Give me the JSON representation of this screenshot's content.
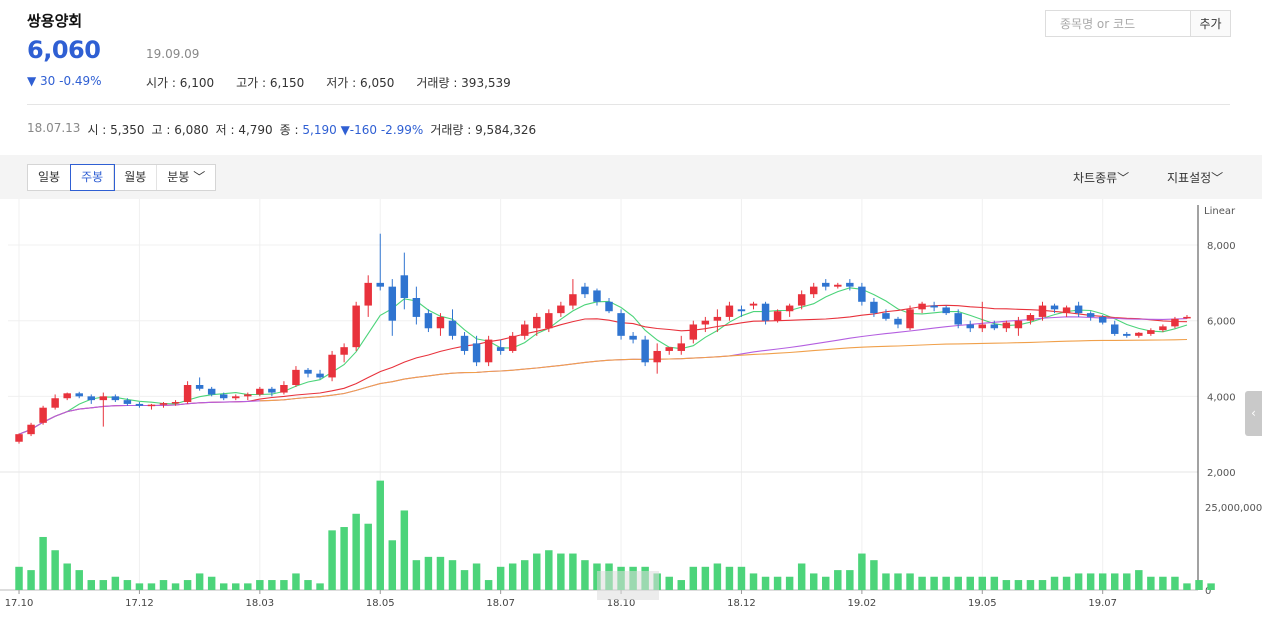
{
  "header": {
    "name": "쌍용양회",
    "price": "6,060",
    "date": "19.09.09",
    "change": "▼ 30 -0.49%",
    "ohlc": [
      {
        "label": "시가",
        "value": "6,100"
      },
      {
        "label": "고가",
        "value": "6,150"
      },
      {
        "label": "저가",
        "value": "6,050"
      },
      {
        "label": "거래량",
        "value": "393,539"
      }
    ]
  },
  "history": {
    "date": "18.07.13",
    "open_label": "시",
    "open": "5,350",
    "high_label": "고",
    "high": "6,080",
    "low_label": "저",
    "low": "4,790",
    "close_label": "종",
    "close": "5,190",
    "change": "▼-160 -2.99%",
    "volume_label": "거래량",
    "volume": "9,584,326"
  },
  "search": {
    "placeholder": "종목명 or 코드",
    "button": "추가"
  },
  "toolbar": {
    "tabs": [
      "일봉",
      "주봉",
      "월봉",
      "분봉"
    ],
    "active_tab": "주봉",
    "chart_type": "차트종류",
    "indicator": "지표설정"
  },
  "colors": {
    "up": "#e8323c",
    "down": "#2f74d0",
    "volume": "#4cd47a",
    "ma5": "#4cd47a",
    "ma20": "#e8323c",
    "ma60": "#b45fe0",
    "ma120": "#f0a04b",
    "accent": "#2f5fd3"
  },
  "chart_data": {
    "type": "candlestick",
    "scale_label": "Linear",
    "price_ticks": [
      2000,
      4000,
      6000,
      8000
    ],
    "price_tick_labels": [
      "2,000",
      "4,000",
      "6,000",
      "8,000"
    ],
    "price_range": [
      2000,
      8900
    ],
    "volume_ticks": [
      0,
      25000000
    ],
    "volume_tick_labels": [
      "0",
      "25,000,000"
    ],
    "volume_range": [
      0,
      35000000
    ],
    "x_labels": [
      "17.10",
      "17.12",
      "18.03",
      "18.05",
      "18.07",
      "18.10",
      "18.12",
      "19.02",
      "19.05",
      "19.07"
    ],
    "x_label_index": [
      0,
      10,
      20,
      30,
      40,
      50,
      60,
      70,
      80,
      90
    ],
    "ohlc": [
      [
        2800,
        3020,
        2750,
        3000
      ],
      [
        3000,
        3300,
        2950,
        3250
      ],
      [
        3300,
        3750,
        3250,
        3700
      ],
      [
        3700,
        4050,
        3650,
        3950
      ],
      [
        3950,
        4100,
        3900,
        4080
      ],
      [
        4080,
        4120,
        3950,
        4000
      ],
      [
        4000,
        4050,
        3800,
        3900
      ],
      [
        3900,
        4100,
        3200,
        4000
      ],
      [
        4000,
        4050,
        3850,
        3900
      ],
      [
        3900,
        3950,
        3750,
        3800
      ],
      [
        3800,
        3850,
        3700,
        3750
      ],
      [
        3750,
        3800,
        3650,
        3780
      ],
      [
        3780,
        3850,
        3700,
        3820
      ],
      [
        3820,
        3900,
        3750,
        3850
      ],
      [
        3850,
        4400,
        3800,
        4300
      ],
      [
        4300,
        4500,
        4150,
        4200
      ],
      [
        4200,
        4250,
        4000,
        4050
      ],
      [
        4050,
        4100,
        3900,
        3950
      ],
      [
        3950,
        4050,
        3900,
        4000
      ],
      [
        4000,
        4100,
        3900,
        4050
      ],
      [
        4050,
        4250,
        4000,
        4200
      ],
      [
        4200,
        4250,
        4000,
        4100
      ],
      [
        4100,
        4400,
        4050,
        4300
      ],
      [
        4300,
        4800,
        4250,
        4700
      ],
      [
        4700,
        4750,
        4500,
        4600
      ],
      [
        4600,
        4700,
        4450,
        4500
      ],
      [
        4500,
        5200,
        4400,
        5100
      ],
      [
        5100,
        5400,
        4900,
        5300
      ],
      [
        5300,
        6500,
        5200,
        6400
      ],
      [
        6400,
        7200,
        6100,
        7000
      ],
      [
        7000,
        8300,
        6800,
        6900
      ],
      [
        6900,
        7100,
        5600,
        6000
      ],
      [
        7200,
        7800,
        6300,
        6600
      ],
      [
        6600,
        6900,
        5900,
        6100
      ],
      [
        6200,
        6300,
        5700,
        5800
      ],
      [
        5800,
        6200,
        5600,
        6100
      ],
      [
        6000,
        6300,
        5500,
        5600
      ],
      [
        5600,
        5700,
        5100,
        5200
      ],
      [
        5400,
        5600,
        4800,
        4900
      ],
      [
        4900,
        5600,
        4800,
        5500
      ],
      [
        5300,
        5500,
        5100,
        5200
      ],
      [
        5200,
        5700,
        5150,
        5600
      ],
      [
        5600,
        6000,
        5500,
        5900
      ],
      [
        5800,
        6200,
        5600,
        6100
      ],
      [
        5800,
        6300,
        5700,
        6200
      ],
      [
        6200,
        6500,
        6100,
        6400
      ],
      [
        6400,
        7100,
        6300,
        6700
      ],
      [
        6900,
        7000,
        6600,
        6700
      ],
      [
        6800,
        6850,
        6400,
        6500
      ],
      [
        6500,
        6600,
        6200,
        6250
      ],
      [
        6200,
        6300,
        5500,
        5600
      ],
      [
        5600,
        5700,
        5400,
        5500
      ],
      [
        5500,
        5600,
        4800,
        4900
      ],
      [
        4900,
        5400,
        4600,
        5200
      ],
      [
        5200,
        5300,
        5100,
        5300
      ],
      [
        5200,
        5600,
        5100,
        5400
      ],
      [
        5500,
        6000,
        5400,
        5900
      ],
      [
        5900,
        6100,
        5700,
        6000
      ],
      [
        6000,
        6300,
        5700,
        6100
      ],
      [
        6100,
        6500,
        6000,
        6400
      ],
      [
        6300,
        6400,
        6100,
        6250
      ],
      [
        6400,
        6500,
        6300,
        6450
      ],
      [
        6450,
        6500,
        5900,
        6000
      ],
      [
        6000,
        6300,
        5950,
        6250
      ],
      [
        6250,
        6450,
        6100,
        6400
      ],
      [
        6400,
        6800,
        6300,
        6700
      ],
      [
        6700,
        7000,
        6600,
        6900
      ],
      [
        7000,
        7100,
        6800,
        6900
      ],
      [
        6900,
        7000,
        6850,
        6950
      ],
      [
        7000,
        7100,
        6800,
        6900
      ],
      [
        6900,
        7000,
        6400,
        6500
      ],
      [
        6500,
        6600,
        6100,
        6200
      ],
      [
        6200,
        6300,
        6000,
        6050
      ],
      [
        6050,
        6100,
        5800,
        5900
      ],
      [
        5800,
        6400,
        5750,
        6300
      ],
      [
        6300,
        6500,
        6200,
        6450
      ],
      [
        6400,
        6500,
        6250,
        6350
      ],
      [
        6350,
        6400,
        6150,
        6200
      ],
      [
        6200,
        6300,
        5800,
        5900
      ],
      [
        5900,
        6000,
        5700,
        5800
      ],
      [
        5800,
        6500,
        5700,
        5900
      ],
      [
        5900,
        6000,
        5750,
        5800
      ],
      [
        5800,
        6000,
        5700,
        5950
      ],
      [
        5800,
        6100,
        5600,
        6000
      ],
      [
        6000,
        6200,
        5900,
        6150
      ],
      [
        6100,
        6500,
        6000,
        6400
      ],
      [
        6400,
        6450,
        6200,
        6300
      ],
      [
        6200,
        6400,
        6100,
        6350
      ],
      [
        6400,
        6500,
        6100,
        6200
      ],
      [
        6200,
        6250,
        6000,
        6100
      ],
      [
        6100,
        6150,
        5900,
        5950
      ],
      [
        5900,
        6000,
        5600,
        5650
      ],
      [
        5650,
        5700,
        5550,
        5600
      ],
      [
        5600,
        5700,
        5550,
        5680
      ],
      [
        5650,
        5800,
        5600,
        5750
      ],
      [
        5750,
        5900,
        5700,
        5850
      ],
      [
        5850,
        6100,
        5800,
        6050
      ],
      [
        6060,
        6150,
        6050,
        6100
      ]
    ],
    "volume_millions": [
      7,
      6,
      16,
      12,
      8,
      6,
      3,
      3,
      4,
      3,
      2,
      2,
      3,
      2,
      3,
      5,
      4,
      2,
      2,
      2,
      3,
      3,
      3,
      5,
      3,
      2,
      18,
      19,
      23,
      20,
      33,
      15,
      24,
      9,
      10,
      10,
      9,
      6,
      8,
      3,
      7,
      8,
      9,
      11,
      12,
      11,
      11,
      9,
      8,
      8,
      7,
      7,
      7,
      5,
      4,
      3,
      7,
      7,
      8,
      7,
      7,
      5,
      4,
      4,
      4,
      8,
      5,
      4,
      6,
      6,
      11,
      9,
      5,
      5,
      5,
      4,
      4,
      4,
      4,
      4,
      4,
      4,
      3,
      3,
      3,
      3,
      4,
      4,
      5,
      5,
      5,
      5,
      5,
      6,
      4,
      4,
      4,
      2,
      3,
      2
    ]
  }
}
